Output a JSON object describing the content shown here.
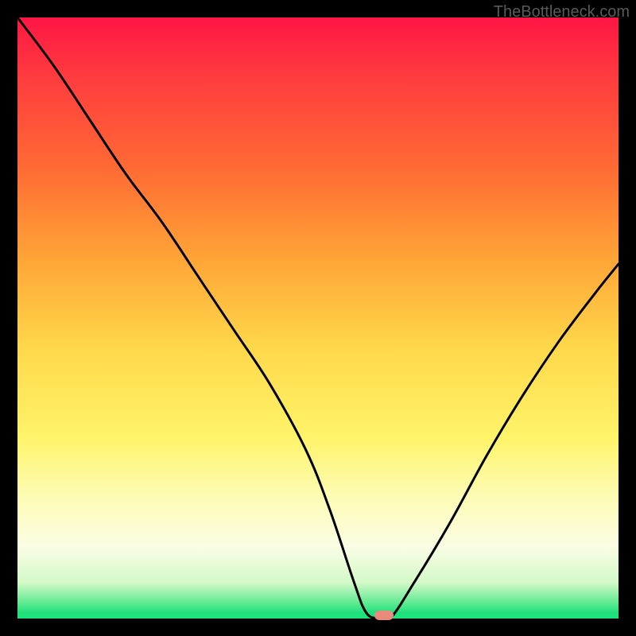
{
  "watermark": "TheBottleneck.com",
  "chart_data": {
    "type": "line",
    "title": "",
    "xlabel": "",
    "ylabel": "",
    "xlim": [
      0,
      100
    ],
    "ylim": [
      0,
      100
    ],
    "series": [
      {
        "name": "bottleneck-curve",
        "x": [
          0,
          6,
          12,
          18,
          24,
          30,
          36,
          42,
          48,
          52,
          56,
          58,
          60,
          62,
          66,
          72,
          78,
          84,
          90,
          96,
          100
        ],
        "values": [
          100,
          92,
          83,
          74,
          66,
          57,
          48,
          39,
          28,
          18,
          6,
          1,
          0,
          0,
          6,
          16,
          27,
          37,
          46,
          54,
          59
        ]
      }
    ],
    "marker": {
      "x": 61,
      "y": 0,
      "color": "#e88a7c"
    },
    "background_gradient": {
      "stops": [
        {
          "pct": 0,
          "color": "#ff1644"
        },
        {
          "pct": 10,
          "color": "#ff3c3e"
        },
        {
          "pct": 25,
          "color": "#ff6a34"
        },
        {
          "pct": 40,
          "color": "#ffa436"
        },
        {
          "pct": 55,
          "color": "#ffd84a"
        },
        {
          "pct": 70,
          "color": "#fff46a"
        },
        {
          "pct": 80,
          "color": "#fdfcb6"
        },
        {
          "pct": 88,
          "color": "#fbfde4"
        },
        {
          "pct": 94,
          "color": "#d4f9c9"
        },
        {
          "pct": 97,
          "color": "#6eec98"
        },
        {
          "pct": 99,
          "color": "#22e07c"
        },
        {
          "pct": 100,
          "color": "#1be47e"
        }
      ]
    }
  }
}
